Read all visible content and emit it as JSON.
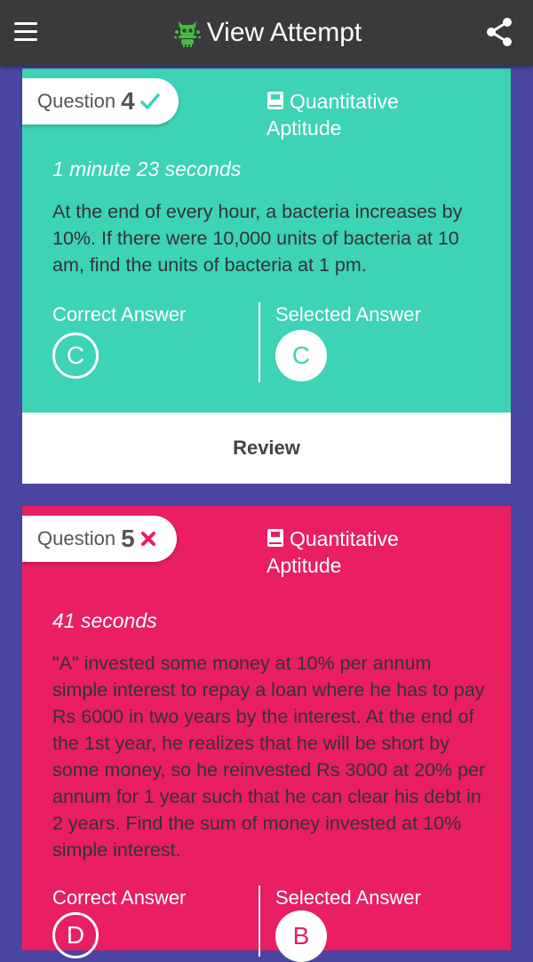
{
  "app": {
    "title": "View Attempt"
  },
  "icons": {
    "menu": "menu-icon",
    "logo": "robot-logo-icon",
    "share": "share-icon",
    "book": "book-icon"
  },
  "colors": {
    "correct": "#3dd3b5",
    "wrong": "#e91e63",
    "background": "#4a45a0",
    "appbar": "#3a3a3c"
  },
  "questions": [
    {
      "label": "Question",
      "number": "4",
      "status": "correct",
      "subject_line1": "Quantitative",
      "subject_line2": "Aptitude",
      "time": "1 minute 23 seconds",
      "text": "At the end of every hour, a bacteria increases by 10%. If there were 10,000 units of bacteria at 10 am, find the units of bacteria at 1 pm.",
      "correct_label": "Correct Answer",
      "selected_label": "Selected Answer",
      "correct_answer": "C",
      "selected_answer": "C",
      "review_label": "Review"
    },
    {
      "label": "Question",
      "number": "5",
      "status": "wrong",
      "subject_line1": "Quantitative",
      "subject_line2": "Aptitude",
      "time": "41 seconds",
      "text": "\"A\" invested some money at 10% per annum simple interest to repay a loan where he has to pay Rs 6000 in two years by the interest. At the end of the 1st year, he realizes that he will be short by some money, so he reinvested Rs 3000 at 20% per annum for 1 year such that he can clear his debt in 2 years. Find the sum of money invested at 10% simple interest.",
      "correct_label": "Correct Answer",
      "selected_label": "Selected Answer",
      "correct_answer": "D",
      "selected_answer": "B"
    }
  ]
}
